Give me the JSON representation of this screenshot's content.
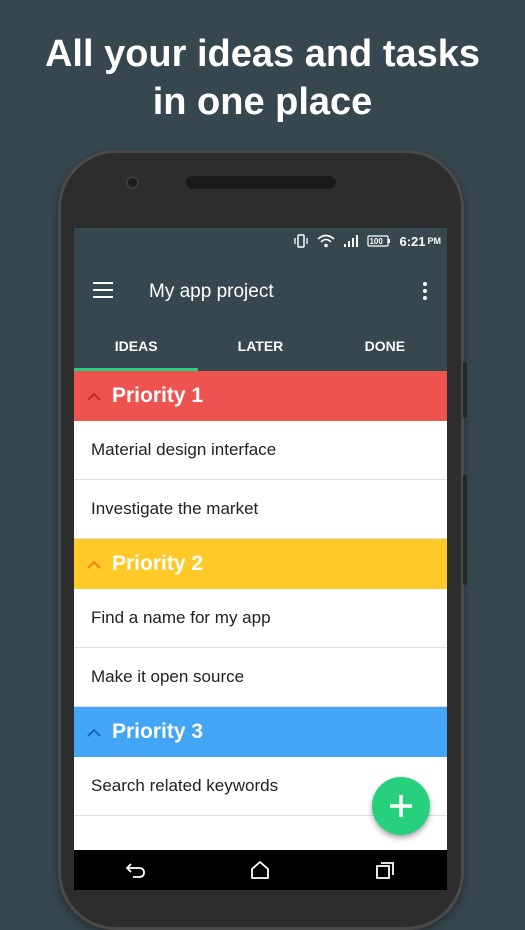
{
  "headline": {
    "line1": "All your ideas and tasks",
    "line2": "in one place"
  },
  "status_bar": {
    "time": "6:21",
    "ampm": "PM",
    "battery": "100",
    "icons": [
      "vibrate-icon",
      "wifi-icon",
      "signal-icon",
      "battery-icon"
    ]
  },
  "toolbar": {
    "title": "My app project",
    "menu_icon": "hamburger-menu-icon",
    "more_icon": "more-vert-icon"
  },
  "tabs": [
    {
      "label": "IDEAS",
      "active": true
    },
    {
      "label": "LATER",
      "active": false
    },
    {
      "label": "DONE",
      "active": false
    }
  ],
  "groups": [
    {
      "title": "Priority 1",
      "color": "#ef5350",
      "chevron_color": "#c62828",
      "tasks": [
        "Material design interface",
        "Investigate the market"
      ]
    },
    {
      "title": "Priority 2",
      "color": "#ffca28",
      "chevron_color": "#f57f17",
      "tasks": [
        "Find a name for my app",
        "Make it open source"
      ]
    },
    {
      "title": "Priority 3",
      "color": "#42a5f5",
      "chevron_color": "#1565c0",
      "tasks": [
        "Search related keywords"
      ]
    }
  ],
  "fab": {
    "icon": "plus-icon",
    "color": "#26d07c"
  },
  "navbar": {
    "icons": [
      "back-icon",
      "home-icon",
      "recents-icon"
    ]
  },
  "colors": {
    "background": "#37474f",
    "app_bar": "#37474f",
    "tab_indicator": "#26d07c"
  }
}
